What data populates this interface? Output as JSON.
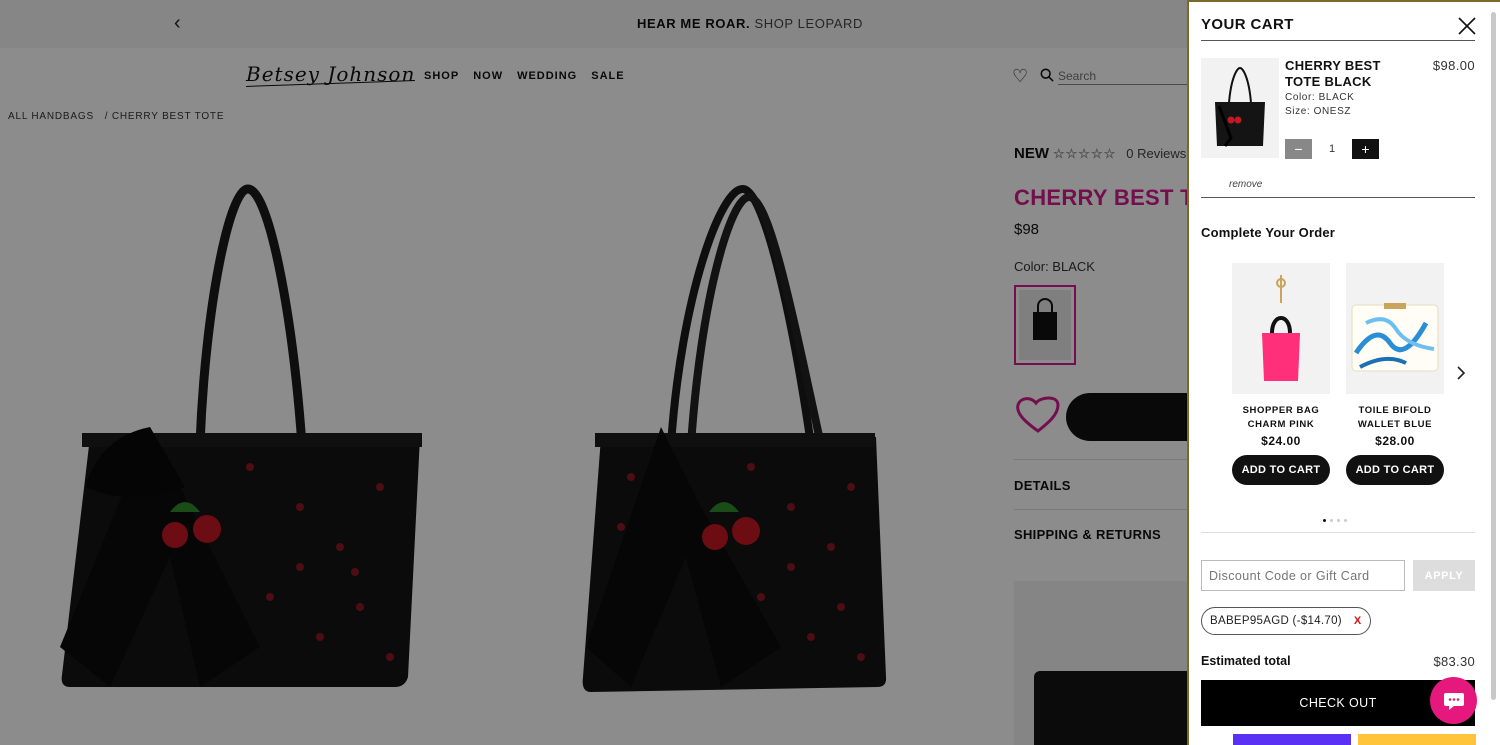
{
  "promo": {
    "bold": "HEAR ME ROAR.",
    "rest": "SHOP LEOPARD"
  },
  "brand": {
    "logo": "Betsey Johnson"
  },
  "nav": [
    "SHOP",
    "NOW",
    "WEDDING",
    "SALE"
  ],
  "search": {
    "placeholder": "Search"
  },
  "breadcrumb": [
    "ALL HANDBAGS",
    "/ CHERRY BEST TOTE"
  ],
  "product": {
    "badge": "NEW",
    "stars": "☆☆☆☆☆",
    "reviews": "0 Reviews",
    "title": "CHERRY BEST TOTE",
    "price": "$98",
    "color_label": "Color: BLACK",
    "accordions": [
      "DETAILS",
      "SHIPPING & RETURNS"
    ]
  },
  "cart": {
    "title": "YOUR CART",
    "item": {
      "name": "CHERRY BEST TOTE BLACK",
      "price": "$98.00",
      "color": "Color: BLACK",
      "size": "Size: ONESZ",
      "qty": "1",
      "minus": "−",
      "plus": "+",
      "remove": "remove"
    },
    "upsell": {
      "title": "Complete Your Order",
      "items": [
        {
          "name": "SHOPPER BAG CHARM PINK",
          "price": "$24.00",
          "button": "ADD TO CART"
        },
        {
          "name": "TOILE BIFOLD WALLET BLUE",
          "price": "$28.00",
          "button": "ADD TO CART"
        }
      ],
      "next_icon": "chevron-right-icon"
    },
    "discount": {
      "placeholder": "Discount Code or Gift Card",
      "apply": "APPLY"
    },
    "applied_code": {
      "text": "BABEP95AGD (-$14.70)",
      "remove": "X"
    },
    "total": {
      "label": "Estimated total",
      "value": "$83.30"
    },
    "checkout": "CHECK OUT"
  },
  "colors": {
    "brand_pink": "#d21c8c",
    "chat_pink": "#e5197d",
    "black": "#111111"
  }
}
